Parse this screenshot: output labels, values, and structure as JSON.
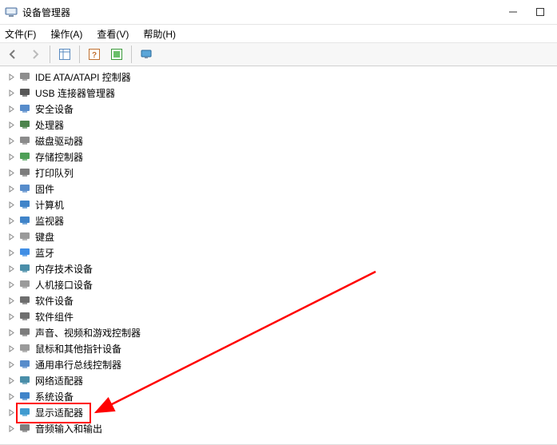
{
  "window": {
    "title": "设备管理器"
  },
  "menubar": {
    "items": [
      {
        "label": "文件(F)"
      },
      {
        "label": "操作(A)"
      },
      {
        "label": "查看(V)"
      },
      {
        "label": "帮助(H)"
      }
    ]
  },
  "toolbar": {
    "buttons": [
      {
        "name": "back-icon"
      },
      {
        "name": "forward-icon"
      },
      {
        "name": "show-hide-icon"
      },
      {
        "name": "help-icon"
      },
      {
        "name": "scan-icon"
      },
      {
        "name": "monitor-icon"
      }
    ]
  },
  "tree": {
    "items": [
      {
        "name": "ide-controller",
        "label": "IDE ATA/ATAPI 控制器",
        "icon_color": "#7a7a7a"
      },
      {
        "name": "usb-connector",
        "label": "USB 连接器管理器",
        "icon_color": "#3a3a3a"
      },
      {
        "name": "security-device",
        "label": "安全设备",
        "icon_color": "#3a78c2"
      },
      {
        "name": "processor",
        "label": "处理器",
        "icon_color": "#2d6f2d"
      },
      {
        "name": "disk-drive",
        "label": "磁盘驱动器",
        "icon_color": "#777"
      },
      {
        "name": "storage-controller",
        "label": "存储控制器",
        "icon_color": "#2f8f3a"
      },
      {
        "name": "print-queue",
        "label": "打印队列",
        "icon_color": "#666"
      },
      {
        "name": "firmware",
        "label": "固件",
        "icon_color": "#3a78c2"
      },
      {
        "name": "computer",
        "label": "计算机",
        "icon_color": "#1e6fbf"
      },
      {
        "name": "monitor",
        "label": "监视器",
        "icon_color": "#1e6fbf"
      },
      {
        "name": "keyboard",
        "label": "键盘",
        "icon_color": "#888"
      },
      {
        "name": "bluetooth",
        "label": "蓝牙",
        "icon_color": "#1e7ae0"
      },
      {
        "name": "memory-tech",
        "label": "内存技术设备",
        "icon_color": "#2a7a9a"
      },
      {
        "name": "hid",
        "label": "人机接口设备",
        "icon_color": "#888"
      },
      {
        "name": "software-device",
        "label": "软件设备",
        "icon_color": "#555"
      },
      {
        "name": "software-component",
        "label": "软件组件",
        "icon_color": "#555"
      },
      {
        "name": "sound-video-game",
        "label": "声音、视频和游戏控制器",
        "icon_color": "#666"
      },
      {
        "name": "mouse-pointer",
        "label": "鼠标和其他指针设备",
        "icon_color": "#888"
      },
      {
        "name": "usb-serial",
        "label": "通用串行总线控制器",
        "icon_color": "#3a78c2"
      },
      {
        "name": "network-adapter",
        "label": "网络适配器",
        "icon_color": "#2a7a9a"
      },
      {
        "name": "system-device",
        "label": "系统设备",
        "icon_color": "#1e6fbf"
      },
      {
        "name": "display-adapter",
        "label": "显示适配器",
        "icon_color": "#1e8ac8"
      },
      {
        "name": "audio-io",
        "label": "音频输入和输出",
        "icon_color": "#666"
      }
    ]
  },
  "annotation": {
    "highlighted_item": "display-adapter",
    "color": "#ff0000"
  }
}
